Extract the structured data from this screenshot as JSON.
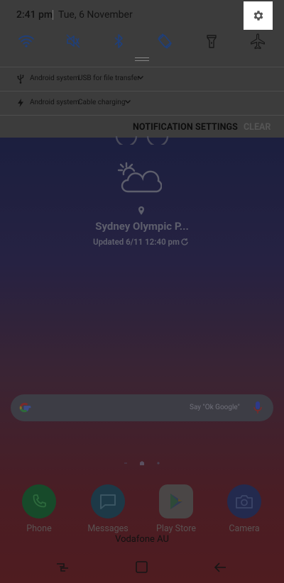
{
  "status_bar": {
    "time": "2:41 pm",
    "date": "Tue, 6 November"
  },
  "quick_settings": [
    {
      "icon": "wifi-icon",
      "active": true
    },
    {
      "icon": "mute-icon",
      "active": true
    },
    {
      "icon": "bluetooth-icon",
      "active": true
    },
    {
      "icon": "auto-rotate-icon",
      "active": true
    },
    {
      "icon": "flashlight-icon",
      "active": false
    },
    {
      "icon": "airplane-mode-icon",
      "active": false
    }
  ],
  "notifications": [
    {
      "icon": "usb-icon",
      "app": "Android system",
      "message": "USB for file transfer"
    },
    {
      "icon": "charging-icon",
      "app": "Android system",
      "message": "Cable charging"
    }
  ],
  "actions": {
    "notification_settings": "NOTIFICATION SETTINGS",
    "clear": "CLEAR"
  },
  "weather": {
    "location": "Sydney Olympic P...",
    "updated": "Updated 6/11 12:40 pm"
  },
  "search": {
    "hint": "Say \"Ok Google\""
  },
  "dock": [
    {
      "label": "Phone",
      "icon": "phone-icon",
      "color": "#174a2a"
    },
    {
      "label": "Messages",
      "icon": "messages-icon",
      "color": "#1d3947"
    },
    {
      "label": "Play Store",
      "icon": "play-store-icon",
      "color": "#4a4646"
    },
    {
      "label": "Camera",
      "icon": "camera-icon",
      "color": "#232a4e"
    }
  ],
  "carrier": "Vodafone AU",
  "colors": {
    "accent": "#1f3f7a",
    "highlight": "#ffffff"
  }
}
